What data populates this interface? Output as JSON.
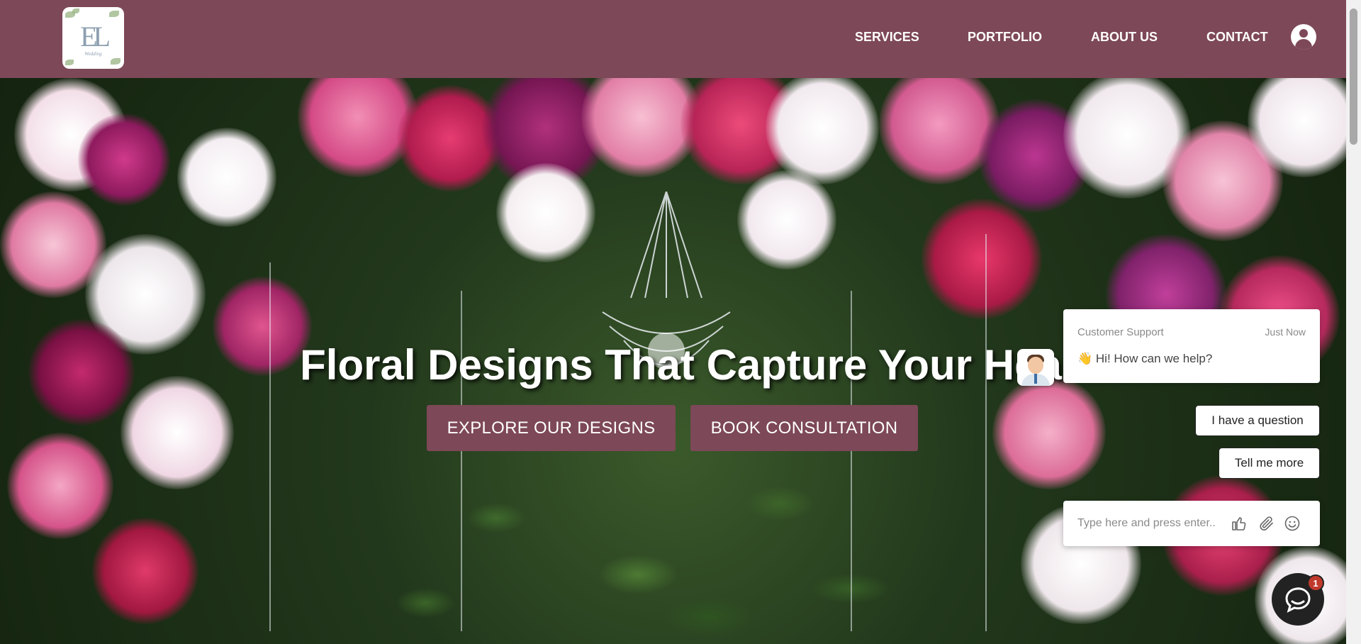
{
  "header": {
    "logo_alt": "EL Wedding logo",
    "logo_monogram": "EL",
    "logo_script": "Wedding",
    "nav": [
      {
        "label": "SERVICES"
      },
      {
        "label": "PORTFOLIO"
      },
      {
        "label": "ABOUT US"
      },
      {
        "label": "CONTACT"
      }
    ],
    "account_icon": "user-circle-icon",
    "brand_color": "#7d4858"
  },
  "hero": {
    "title": "Floral Designs That Capture Your Hea",
    "primary_button": "EXPLORE OUR DESIGNS",
    "secondary_button": "BOOK CONSULTATION"
  },
  "chat": {
    "agent_name": "Customer Support",
    "timestamp": "Just Now",
    "greeting": "👋 Hi! How can we help?",
    "quick_replies": [
      "I have a question",
      "Tell me more"
    ],
    "input_placeholder": "Type here and press enter..",
    "icons": [
      "thumbs-up-icon",
      "paperclip-icon",
      "smiley-icon"
    ],
    "unread_count": "1"
  }
}
